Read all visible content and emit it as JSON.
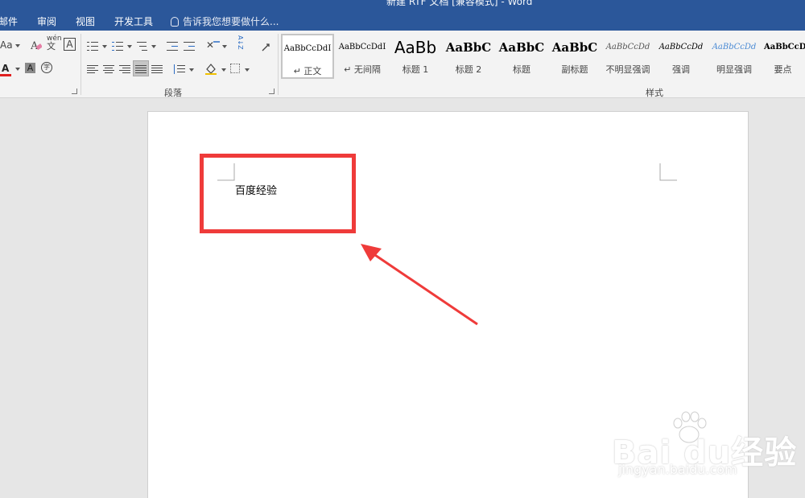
{
  "window": {
    "title": "新建 RTF 文档 [兼容模式] - Word"
  },
  "menu": {
    "tabs": [
      "邮件",
      "审阅",
      "视图",
      "开发工具"
    ],
    "tell_me": "告诉我您想要做什么..."
  },
  "ribbon": {
    "font_group": {
      "change_case": "Aa",
      "phonetic": "wén",
      "phonetic_char": "文",
      "char_border": "A",
      "font_color": "A",
      "char_shading": "A",
      "enclose_char": "字"
    },
    "paragraph_group": {
      "label": "段落",
      "sort_label": "A↓Z"
    },
    "styles_group": {
      "label": "样式",
      "items": [
        {
          "sample": "AaBbCcDdI",
          "name": "↵ 正文",
          "selected": true
        },
        {
          "sample": "AaBbCcDdI",
          "name": "↵ 无间隔",
          "selected": false
        },
        {
          "sample": "AaBb",
          "name": "标题 1",
          "selected": false
        },
        {
          "sample": "AaBbC",
          "name": "标题 2",
          "selected": false
        },
        {
          "sample": "AaBbC",
          "name": "标题",
          "selected": false
        },
        {
          "sample": "AaBbC",
          "name": "副标题",
          "selected": false
        },
        {
          "sample": "AaBbCcDd",
          "name": "不明显强调",
          "selected": false
        },
        {
          "sample": "AaBbCcDd",
          "name": "强调",
          "selected": false
        },
        {
          "sample": "AaBbCcDd",
          "name": "明显强调",
          "selected": false
        },
        {
          "sample": "AaBbCcD",
          "name": "要点",
          "selected": false
        }
      ]
    }
  },
  "document": {
    "body_text": "百度经验"
  },
  "watermark": {
    "logo": "Bai du经验",
    "url": "jingyan.baidu.com"
  },
  "colors": {
    "titlebar": "#2b579a",
    "ribbon": "#f3f3f3",
    "canvas": "#e6e6e6",
    "highlight": "#ef3b3a",
    "font_color_bar": "#e02020"
  }
}
